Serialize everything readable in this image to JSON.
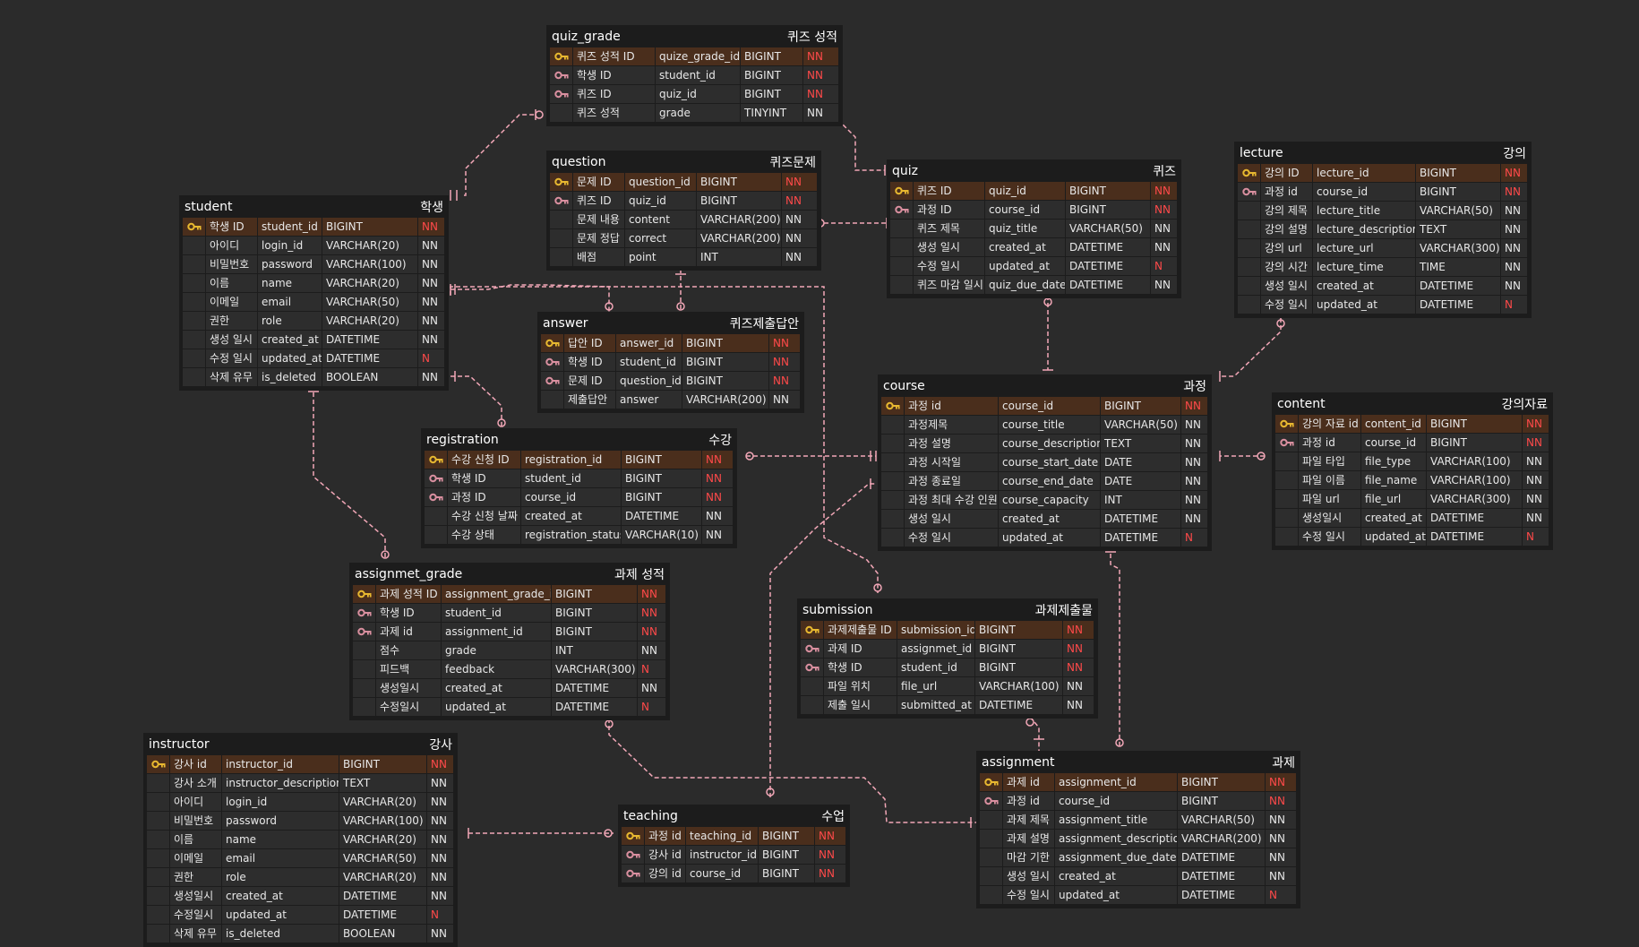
{
  "colors": {
    "background": "#2b2b2b",
    "line": "#f2a7b7",
    "primary_key_row": "#4a2e1c",
    "pk_key_icon": "#e8b830",
    "fk_key_icon": "#d98f9f",
    "nn_red": "#ff4a4a"
  },
  "tables": [
    {
      "id": "quiz_grade",
      "name": "quiz_grade",
      "label": "퀴즈 성적",
      "rows": [
        {
          "key": "pk",
          "k": "퀴즈 성적 ID",
          "c": "quize_grade_id",
          "t": "BIGINT",
          "n": "NN",
          "red": true
        },
        {
          "key": "fk",
          "k": "학생 ID",
          "c": "student_id",
          "t": "BIGINT",
          "n": "NN",
          "red": true
        },
        {
          "key": "fk",
          "k": "퀴즈 ID",
          "c": "quiz_id",
          "t": "BIGINT",
          "n": "NN",
          "red": true
        },
        {
          "key": "",
          "k": "퀴즈 성적",
          "c": "grade",
          "t": "TINYINT",
          "n": "NN",
          "red": false
        }
      ]
    },
    {
      "id": "question",
      "name": "question",
      "label": "퀴즈문제",
      "rows": [
        {
          "key": "pk",
          "k": "문제 ID",
          "c": "question_id",
          "t": "BIGINT",
          "n": "NN",
          "red": true
        },
        {
          "key": "fk",
          "k": "퀴즈 ID",
          "c": "quiz_id",
          "t": "BIGINT",
          "n": "NN",
          "red": true
        },
        {
          "key": "",
          "k": "문제 내용",
          "c": "content",
          "t": "VARCHAR(200)",
          "n": "NN",
          "red": false
        },
        {
          "key": "",
          "k": "문제 정답",
          "c": "correct",
          "t": "VARCHAR(200)",
          "n": "NN",
          "red": false
        },
        {
          "key": "",
          "k": "배점",
          "c": "point",
          "t": "INT",
          "n": "NN",
          "red": false
        }
      ]
    },
    {
      "id": "quiz",
      "name": "quiz",
      "label": "퀴즈",
      "rows": [
        {
          "key": "pk",
          "k": "퀴즈 ID",
          "c": "quiz_id",
          "t": "BIGINT",
          "n": "NN",
          "red": true
        },
        {
          "key": "fk",
          "k": "과정 ID",
          "c": "course_id",
          "t": "BIGINT",
          "n": "NN",
          "red": true
        },
        {
          "key": "",
          "k": "퀴즈 제목",
          "c": "quiz_title",
          "t": "VARCHAR(50)",
          "n": "NN",
          "red": false
        },
        {
          "key": "",
          "k": "생성 일시",
          "c": "created_at",
          "t": "DATETIME",
          "n": "NN",
          "red": false
        },
        {
          "key": "",
          "k": "수정 일시",
          "c": "updated_at",
          "t": "DATETIME",
          "n": "N",
          "red": true
        },
        {
          "key": "",
          "k": "퀴즈 마감 일시",
          "c": "quiz_due_date",
          "t": "DATETIME",
          "n": "NN",
          "red": false
        }
      ]
    },
    {
      "id": "lecture",
      "name": "lecture",
      "label": "강의",
      "rows": [
        {
          "key": "pk",
          "k": "강의 ID",
          "c": "lecture_id",
          "t": "BIGINT",
          "n": "NN",
          "red": true
        },
        {
          "key": "fk",
          "k": "과정 id",
          "c": "course_id",
          "t": "BIGINT",
          "n": "NN",
          "red": true
        },
        {
          "key": "",
          "k": "강의 제목",
          "c": "lecture_title",
          "t": "VARCHAR(50)",
          "n": "NN",
          "red": false
        },
        {
          "key": "",
          "k": "강의 설명",
          "c": "lecture_description",
          "t": "TEXT",
          "n": "NN",
          "red": false
        },
        {
          "key": "",
          "k": "강의 url",
          "c": "lecture_url",
          "t": "VARCHAR(300)",
          "n": "NN",
          "red": false
        },
        {
          "key": "",
          "k": "강의 시간",
          "c": "lecture_time",
          "t": "TIME",
          "n": "NN",
          "red": false
        },
        {
          "key": "",
          "k": "생성 일시",
          "c": "created_at",
          "t": "DATETIME",
          "n": "NN",
          "red": false
        },
        {
          "key": "",
          "k": "수정 일시",
          "c": "updated_at",
          "t": "DATETIME",
          "n": "N",
          "red": true
        }
      ]
    },
    {
      "id": "student",
      "name": "student",
      "label": "학생",
      "rows": [
        {
          "key": "pk",
          "k": "학생 ID",
          "c": "student_id",
          "t": "BIGINT",
          "n": "NN",
          "red": true
        },
        {
          "key": "",
          "k": "아이디",
          "c": "login_id",
          "t": "VARCHAR(20)",
          "n": "NN",
          "red": false
        },
        {
          "key": "",
          "k": "비밀번호",
          "c": "password",
          "t": "VARCHAR(100)",
          "n": "NN",
          "red": false
        },
        {
          "key": "",
          "k": "이름",
          "c": "name",
          "t": "VARCHAR(20)",
          "n": "NN",
          "red": false
        },
        {
          "key": "",
          "k": "이메일",
          "c": "email",
          "t": "VARCHAR(50)",
          "n": "NN",
          "red": false
        },
        {
          "key": "",
          "k": "권한",
          "c": "role",
          "t": "VARCHAR(20)",
          "n": "NN",
          "red": false
        },
        {
          "key": "",
          "k": "생성 일시",
          "c": "created_at",
          "t": "DATETIME",
          "n": "NN",
          "red": false
        },
        {
          "key": "",
          "k": "수정 일시",
          "c": "updated_at",
          "t": "DATETIME",
          "n": "N",
          "red": true
        },
        {
          "key": "",
          "k": "삭제 유무",
          "c": "is_deleted",
          "t": "BOOLEAN",
          "n": "NN",
          "red": false
        }
      ]
    },
    {
      "id": "answer",
      "name": "answer",
      "label": "퀴즈제출답안",
      "rows": [
        {
          "key": "pk",
          "k": "답안 ID",
          "c": "answer_id",
          "t": "BIGINT",
          "n": "NN",
          "red": true
        },
        {
          "key": "fk",
          "k": "학생 ID",
          "c": "student_id",
          "t": "BIGINT",
          "n": "NN",
          "red": true
        },
        {
          "key": "fk",
          "k": "문제 ID",
          "c": "question_id",
          "t": "BIGINT",
          "n": "NN",
          "red": true
        },
        {
          "key": "",
          "k": "제출답안",
          "c": "answer",
          "t": "VARCHAR(200)",
          "n": "NN",
          "red": false
        }
      ]
    },
    {
      "id": "course",
      "name": "course",
      "label": "과정",
      "rows": [
        {
          "key": "pk",
          "k": "과정 id",
          "c": "course_id",
          "t": "BIGINT",
          "n": "NN",
          "red": true
        },
        {
          "key": "",
          "k": "과정제목",
          "c": "course_title",
          "t": "VARCHAR(50)",
          "n": "NN",
          "red": false
        },
        {
          "key": "",
          "k": "과정 설명",
          "c": "course_description",
          "t": "TEXT",
          "n": "NN",
          "red": false
        },
        {
          "key": "",
          "k": "과정 시작일",
          "c": "course_start_date",
          "t": "DATE",
          "n": "NN",
          "red": false
        },
        {
          "key": "",
          "k": "과정 종료일",
          "c": "course_end_date",
          "t": "DATE",
          "n": "NN",
          "red": false
        },
        {
          "key": "",
          "k": "과정 최대 수강 인원",
          "c": "course_capacity",
          "t": "INT",
          "n": "NN",
          "red": false
        },
        {
          "key": "",
          "k": "생성 일시",
          "c": "created_at",
          "t": "DATETIME",
          "n": "NN",
          "red": false
        },
        {
          "key": "",
          "k": "수정 일시",
          "c": "updated_at",
          "t": "DATETIME",
          "n": "N",
          "red": true
        }
      ]
    },
    {
      "id": "content",
      "name": "content",
      "label": "강의자료",
      "rows": [
        {
          "key": "pk",
          "k": "강의 자료 id",
          "c": "content_id",
          "t": "BIGINT",
          "n": "NN",
          "red": true
        },
        {
          "key": "fk",
          "k": "과정 id",
          "c": "course_id",
          "t": "BIGINT",
          "n": "NN",
          "red": true
        },
        {
          "key": "",
          "k": "파일 타입",
          "c": "file_type",
          "t": "VARCHAR(100)",
          "n": "NN",
          "red": false
        },
        {
          "key": "",
          "k": "파일 이름",
          "c": "file_name",
          "t": "VARCHAR(100)",
          "n": "NN",
          "red": false
        },
        {
          "key": "",
          "k": "파일 url",
          "c": "file_url",
          "t": "VARCHAR(300)",
          "n": "NN",
          "red": false
        },
        {
          "key": "",
          "k": "생성일시",
          "c": "created_at",
          "t": "DATETIME",
          "n": "NN",
          "red": false
        },
        {
          "key": "",
          "k": "수정 일시",
          "c": "updated_at",
          "t": "DATETIME",
          "n": "N",
          "red": true
        }
      ]
    },
    {
      "id": "registration",
      "name": "registration",
      "label": "수강",
      "rows": [
        {
          "key": "pk",
          "k": "수강 신청 ID",
          "c": "registration_id",
          "t": "BIGINT",
          "n": "NN",
          "red": true
        },
        {
          "key": "fk",
          "k": "학생 ID",
          "c": "student_id",
          "t": "BIGINT",
          "n": "NN",
          "red": true
        },
        {
          "key": "fk",
          "k": "과정 ID",
          "c": "course_id",
          "t": "BIGINT",
          "n": "NN",
          "red": true
        },
        {
          "key": "",
          "k": "수강 신청 날짜",
          "c": "created_at",
          "t": "DATETIME",
          "n": "NN",
          "red": false
        },
        {
          "key": "",
          "k": "수강 상태",
          "c": "registration_status",
          "t": "VARCHAR(10)",
          "n": "NN",
          "red": false
        }
      ]
    },
    {
      "id": "assignmet_grade",
      "name": "assignmet_grade",
      "label": "과제 성적",
      "rows": [
        {
          "key": "pk",
          "k": "과제 성적 ID",
          "c": "assignment_grade_id",
          "t": "BIGINT",
          "n": "NN",
          "red": true
        },
        {
          "key": "fk",
          "k": "학생 ID",
          "c": "student_id",
          "t": "BIGINT",
          "n": "NN",
          "red": true
        },
        {
          "key": "fk",
          "k": "과제 id",
          "c": "assignment_id",
          "t": "BIGINT",
          "n": "NN",
          "red": true
        },
        {
          "key": "",
          "k": "점수",
          "c": "grade",
          "t": "INT",
          "n": "NN",
          "red": false
        },
        {
          "key": "",
          "k": "피드백",
          "c": "feedback",
          "t": "VARCHAR(300)",
          "n": "N",
          "red": true
        },
        {
          "key": "",
          "k": "생성일시",
          "c": "created_at",
          "t": "DATETIME",
          "n": "NN",
          "red": false
        },
        {
          "key": "",
          "k": "수정일시",
          "c": "updated_at",
          "t": "DATETIME",
          "n": "N",
          "red": true
        }
      ]
    },
    {
      "id": "submission",
      "name": "submission",
      "label": "과제제출물",
      "rows": [
        {
          "key": "pk",
          "k": "과제제출물 ID",
          "c": "submission_id",
          "t": "BIGINT",
          "n": "NN",
          "red": true
        },
        {
          "key": "fk",
          "k": "과제 ID",
          "c": "assignmet_id",
          "t": "BIGINT",
          "n": "NN",
          "red": true
        },
        {
          "key": "fk",
          "k": "학생 ID",
          "c": "student_id",
          "t": "BIGINT",
          "n": "NN",
          "red": true
        },
        {
          "key": "",
          "k": "파일 위치",
          "c": "file_url",
          "t": "VARCHAR(100)",
          "n": "NN",
          "red": false
        },
        {
          "key": "",
          "k": "제출 일시",
          "c": "submitted_at",
          "t": "DATETIME",
          "n": "NN",
          "red": false
        }
      ]
    },
    {
      "id": "instructor",
      "name": "instructor",
      "label": "강사",
      "rows": [
        {
          "key": "pk",
          "k": "강사 id",
          "c": "instructor_id",
          "t": "BIGINT",
          "n": "NN",
          "red": true
        },
        {
          "key": "",
          "k": "강사 소개",
          "c": "instructor_description",
          "t": "TEXT",
          "n": "NN",
          "red": false
        },
        {
          "key": "",
          "k": "아이디",
          "c": "login_id",
          "t": "VARCHAR(20)",
          "n": "NN",
          "red": false
        },
        {
          "key": "",
          "k": "비밀번호",
          "c": "password",
          "t": "VARCHAR(100)",
          "n": "NN",
          "red": false
        },
        {
          "key": "",
          "k": "이름",
          "c": "name",
          "t": "VARCHAR(20)",
          "n": "NN",
          "red": false
        },
        {
          "key": "",
          "k": "이메일",
          "c": "email",
          "t": "VARCHAR(50)",
          "n": "NN",
          "red": false
        },
        {
          "key": "",
          "k": "권한",
          "c": "role",
          "t": "VARCHAR(20)",
          "n": "NN",
          "red": false
        },
        {
          "key": "",
          "k": "생성일시",
          "c": "created_at",
          "t": "DATETIME",
          "n": "NN",
          "red": false
        },
        {
          "key": "",
          "k": "수정일시",
          "c": "updated_at",
          "t": "DATETIME",
          "n": "N",
          "red": true
        },
        {
          "key": "",
          "k": "삭제 유무",
          "c": "is_deleted",
          "t": "BOOLEAN",
          "n": "NN",
          "red": false
        }
      ]
    },
    {
      "id": "teaching",
      "name": "teaching",
      "label": "수업",
      "rows": [
        {
          "key": "pk",
          "k": "과정 id",
          "c": "teaching_id",
          "t": "BIGINT",
          "n": "NN",
          "red": true
        },
        {
          "key": "fk",
          "k": "강사 id",
          "c": "instructor_id",
          "t": "BIGINT",
          "n": "NN",
          "red": true
        },
        {
          "key": "fk",
          "k": "강의 id",
          "c": "course_id",
          "t": "BIGINT",
          "n": "NN",
          "red": true
        }
      ]
    },
    {
      "id": "assignment",
      "name": "assignment",
      "label": "과제",
      "rows": [
        {
          "key": "pk",
          "k": "과제 id",
          "c": "assignment_id",
          "t": "BIGINT",
          "n": "NN",
          "red": true
        },
        {
          "key": "fk",
          "k": "과정 id",
          "c": "course_id",
          "t": "BIGINT",
          "n": "NN",
          "red": true
        },
        {
          "key": "",
          "k": "과제 제목",
          "c": "assignment_title",
          "t": "VARCHAR(50)",
          "n": "NN",
          "red": false
        },
        {
          "key": "",
          "k": "과제 설명",
          "c": "assignment_description",
          "t": "VARCHAR(200)",
          "n": "NN",
          "red": false
        },
        {
          "key": "",
          "k": "마감 기한",
          "c": "assignment_due_date",
          "t": "DATETIME",
          "n": "NN",
          "red": false
        },
        {
          "key": "",
          "k": "생성 일시",
          "c": "created_at",
          "t": "DATETIME",
          "n": "NN",
          "red": false
        },
        {
          "key": "",
          "k": "수정 일시",
          "c": "updated_at",
          "t": "DATETIME",
          "n": "N",
          "red": true
        }
      ]
    }
  ]
}
